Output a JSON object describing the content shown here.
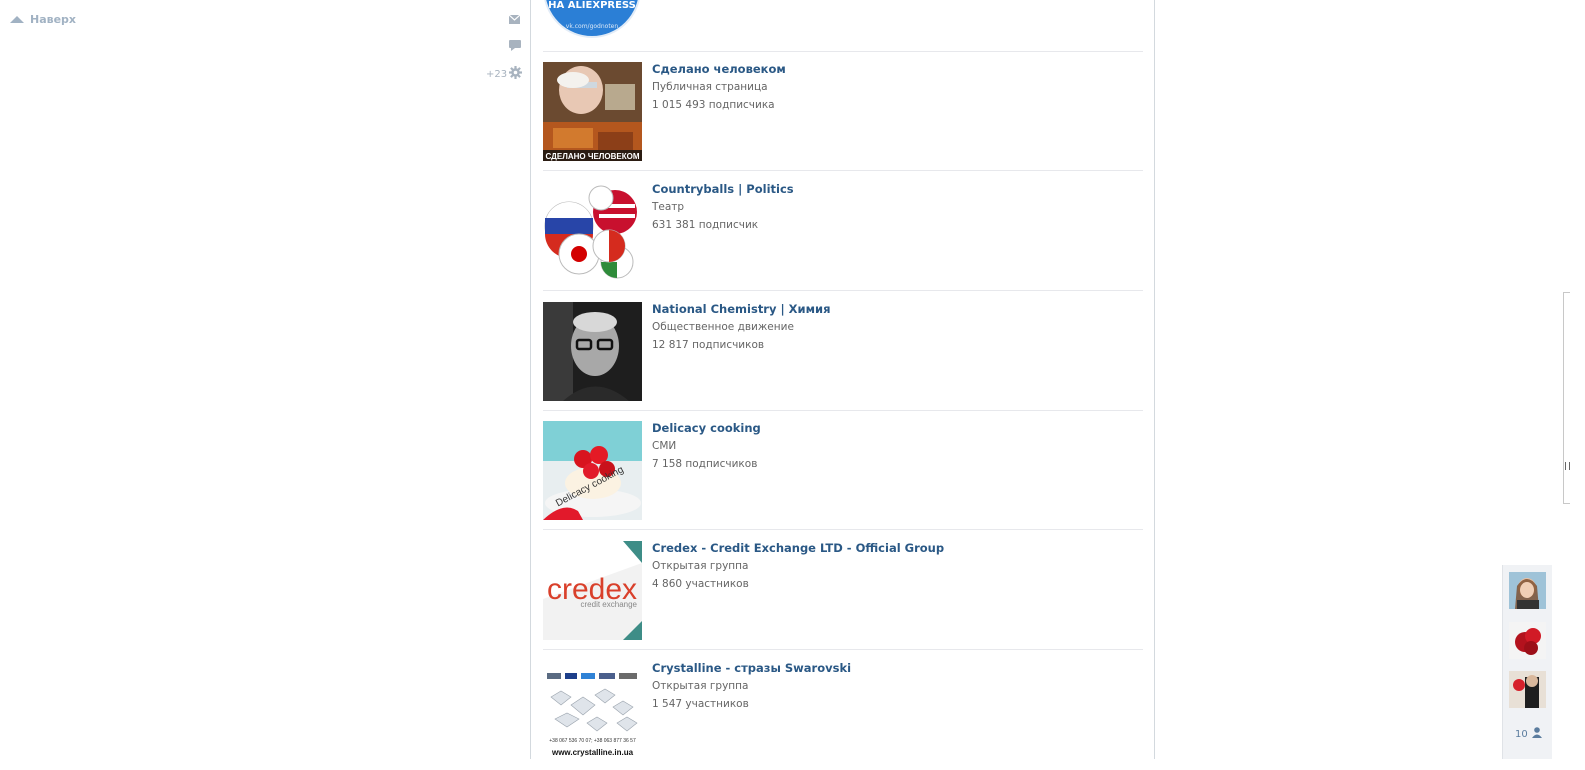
{
  "top_link": {
    "label": "Наверх",
    "icon": "arrow-up-icon"
  },
  "left_icons": {
    "mail": "envelope-icon",
    "chat": "chat-bubble-icon",
    "notifications": "gear-icon"
  },
  "notifications_count": "+23",
  "promo": {
    "line1": "НА ALIEXPRESS",
    "line2": "vk.com/godnoten"
  },
  "groups": [
    {
      "name": "Сделано человеком",
      "type": "Публичная страница",
      "count": "1 015 493 подписчика",
      "thumb_caption": "СДЕЛАНО ЧЕЛОВЕКОМ"
    },
    {
      "name": "Countryballs | Politics",
      "type": "Театр",
      "count": "631 381 подписчик"
    },
    {
      "name": "National Chemistry | Химия",
      "type": "Общественное движение",
      "count": "12 817 подписчиков"
    },
    {
      "name": "Delicacy cooking",
      "type": "СМИ",
      "count": "7 158 подписчиков",
      "thumb_caption": "Delicacy cooking"
    },
    {
      "name": "Credex - Credit Exchange LTD - Official Group",
      "type": "Открытая группа",
      "count": "4 860 участников",
      "thumb_caption": "credex",
      "thumb_sub": "credit exchange"
    },
    {
      "name": "Crystalline - стразы Swarovski",
      "type": "Открытая группа",
      "count": "1 547 участников",
      "thumb_caption": "www.crystalline.in.ua",
      "thumb_phones": "+38 067 536 70 07; +38 063 877 36 57"
    }
  ],
  "friends_online": {
    "count": "10",
    "icon": "person-icon"
  },
  "colors": {
    "link": "#2a5885",
    "muted": "#656565",
    "top_link": "#a1b2c3",
    "promo_blue": "#2b7fd6",
    "credex_red": "#d9402b",
    "credex_teal": "#3e8d87"
  }
}
